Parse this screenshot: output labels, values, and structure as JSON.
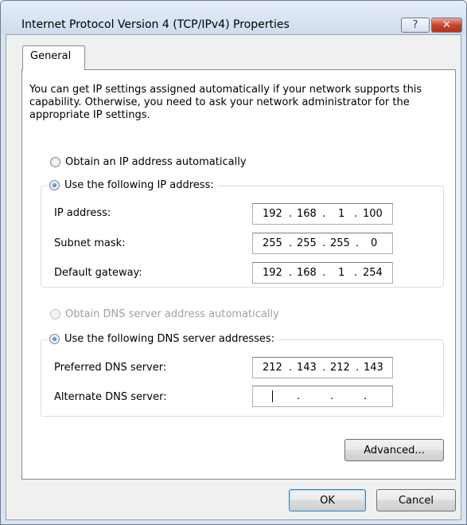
{
  "window": {
    "title": "Internet Protocol Version 4 (TCP/IPv4) Properties",
    "help_label": "?",
    "close_label": "✕"
  },
  "tabs": [
    {
      "label": "General"
    }
  ],
  "intro": "You can get IP settings assigned automatically if your network supports this capability. Otherwise, you need to ask your network administrator for the appropriate IP settings.",
  "ip": {
    "auto_label": "Obtain an IP address automatically",
    "manual_label": "Use the following IP address:",
    "fields": {
      "ip_address": {
        "label": "IP address:",
        "octets": [
          "192",
          "168",
          "1",
          "100"
        ]
      },
      "subnet_mask": {
        "label": "Subnet mask:",
        "octets": [
          "255",
          "255",
          "255",
          "0"
        ]
      },
      "default_gateway": {
        "label": "Default gateway:",
        "octets": [
          "192",
          "168",
          "1",
          "254"
        ]
      }
    }
  },
  "dns": {
    "auto_label": "Obtain DNS server address automatically",
    "manual_label": "Use the following DNS server addresses:",
    "fields": {
      "preferred": {
        "label": "Preferred DNS server:",
        "octets": [
          "212",
          "143",
          "212",
          "143"
        ]
      },
      "alternate": {
        "label": "Alternate DNS server:",
        "octets": [
          "",
          "",
          "",
          ""
        ]
      }
    }
  },
  "separator": ".",
  "buttons": {
    "advanced": "Advanced...",
    "ok": "OK",
    "cancel": "Cancel"
  }
}
